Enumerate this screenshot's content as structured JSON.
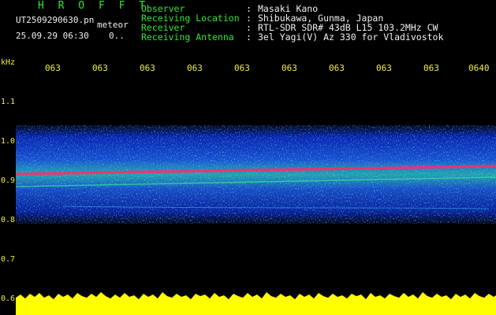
{
  "header": {
    "brand": "H R O F F T",
    "filename": "UT2509290630.pn",
    "meteor_label": "meteor",
    "datetime": "25.09.29 06:30",
    "count": "0..",
    "info": [
      {
        "label": "Observer",
        "value": "Masaki Kano"
      },
      {
        "label": "Receiving Location",
        "value": "Shibukawa, Gunma, Japan"
      },
      {
        "label": "Receiver",
        "value": "RTL-SDR SDR# 43dB L15 103.2MHz CW"
      },
      {
        "label": "Receiving Antenna",
        "value": "3el Yagi(V) Az 330 for Vladivostok"
      }
    ],
    "colon": ":"
  },
  "axis": {
    "y_unit": "kHz",
    "y_ticks": [
      "1.1",
      "1.0",
      "0.9",
      "0.8",
      "0.7",
      "0.6"
    ],
    "x_ticks": [
      "063",
      "063",
      "063",
      "063",
      "063",
      "063",
      "063",
      "063",
      "063",
      "0640"
    ]
  },
  "colors": {
    "label": "#2ee82e",
    "axis": "#f2ef3a",
    "value": "#f0f0f0",
    "spectrum_low": "#0a1f9c",
    "spectrum_mid": "#2fd4e8",
    "spectrum_high": "#ff2a6a",
    "noise_floor": "#ffff00"
  }
}
